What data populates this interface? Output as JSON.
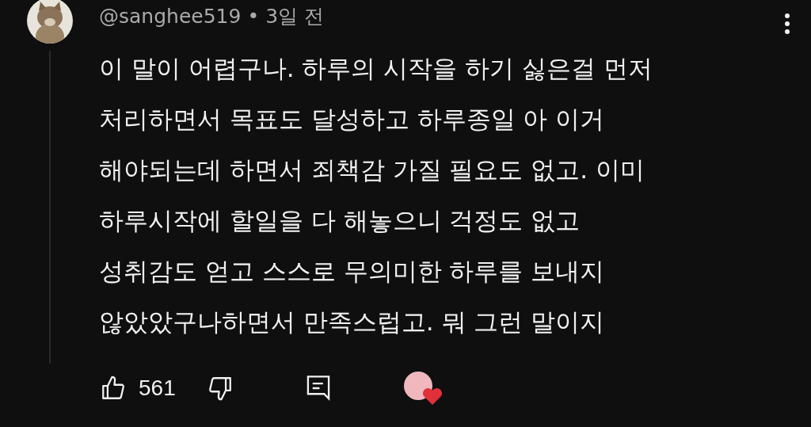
{
  "comment": {
    "author": "@sanghee519",
    "separator": "•",
    "time": "3일 전",
    "lines": [
      "이 말이 어렵구나. 하루의 시작을 하기 싫은걸 먼저",
      "처리하면서 목표도 달성하고 하루종일 아 이거",
      "해야되는데 하면서 죄책감 가질 필요도 없고. 이미",
      "하루시작에 할일을 다 해놓으니 걱정도 없고",
      "성취감도 얻고 스스로 무의미한 하루를 보내지",
      "않았았구나하면서 만족스럽고. 뭐 그런 말이지"
    ],
    "likes": "561",
    "creator_hearted": true
  }
}
